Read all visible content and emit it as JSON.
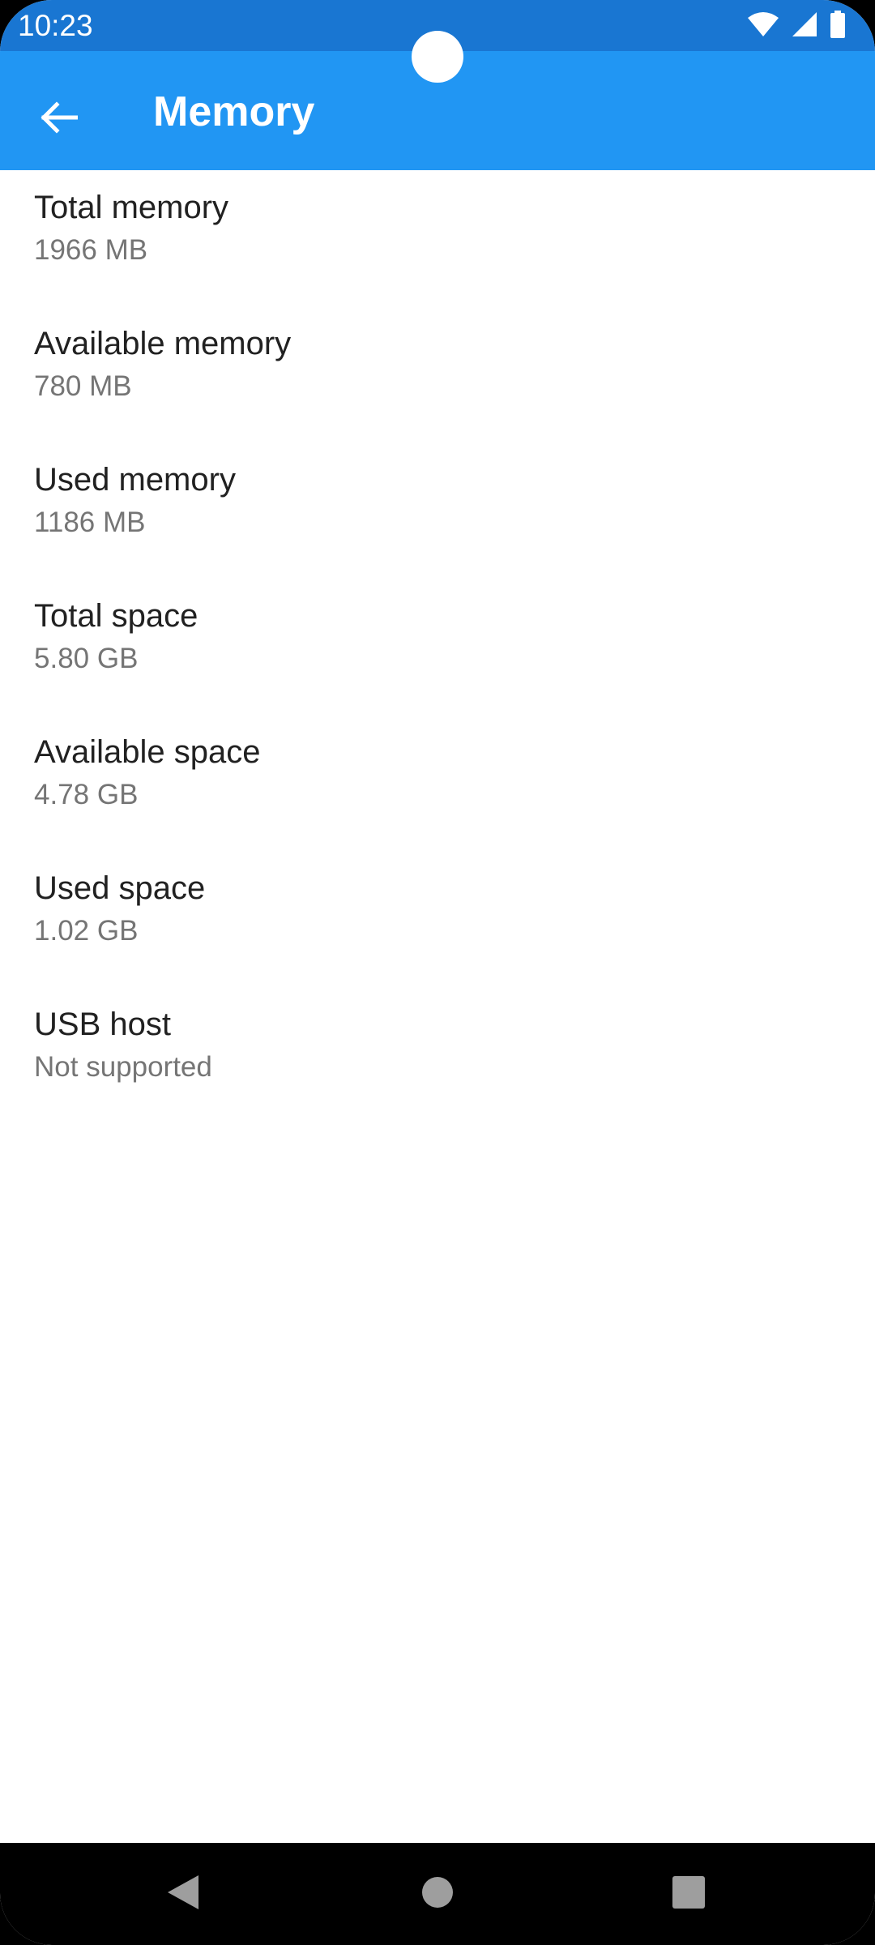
{
  "status_bar": {
    "time": "10:23",
    "icons": [
      "wifi-icon",
      "cellular-signal-icon",
      "battery-icon"
    ]
  },
  "app_bar": {
    "title": "Memory",
    "back_icon": "arrow-back-icon"
  },
  "items": [
    {
      "label": "Total memory",
      "value": "1966 MB"
    },
    {
      "label": "Available memory",
      "value": "780 MB"
    },
    {
      "label": "Used memory",
      "value": "1186 MB"
    },
    {
      "label": "Total space",
      "value": "5.80 GB"
    },
    {
      "label": "Available space",
      "value": "4.78 GB"
    },
    {
      "label": "Used space",
      "value": "1.02 GB"
    },
    {
      "label": "USB host",
      "value": "Not supported"
    }
  ],
  "nav_bar": {
    "icons": [
      "nav-back-icon",
      "nav-home-icon",
      "nav-recents-icon"
    ]
  },
  "colors": {
    "status_bar": "#1976D2",
    "app_bar": "#2196F3",
    "label_text": "#212121",
    "value_text": "#757575"
  }
}
